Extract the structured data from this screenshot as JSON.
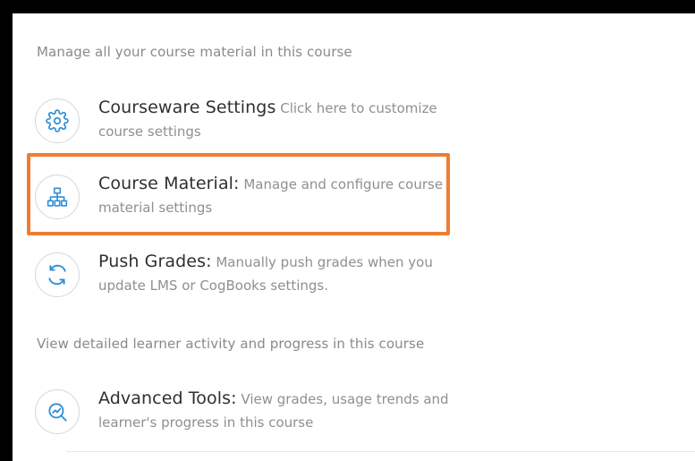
{
  "sections": {
    "manage_heading": "Manage all your course material in this course",
    "learner_heading": "View detailed learner activity and progress in this course"
  },
  "items": [
    {
      "title": "Courseware Settings",
      "description": "Click here to customize course settings",
      "icon": "gear-icon"
    },
    {
      "title": "Course Material:",
      "description": "Manage and configure course material settings",
      "icon": "hierarchy-icon"
    },
    {
      "title": "Push Grades:",
      "description": "Manually push grades when you update LMS or CogBooks settings.",
      "icon": "sync-icon"
    },
    {
      "title": "Advanced Tools:",
      "description": "View grades, usage trends and learner's progress in this course",
      "icon": "analytics-search-icon"
    }
  ],
  "colors": {
    "highlight": "#ee7d31",
    "icon_blue": "#2f8fd8",
    "title_text": "#2f2f2f",
    "muted_text": "#8f8f8f"
  }
}
